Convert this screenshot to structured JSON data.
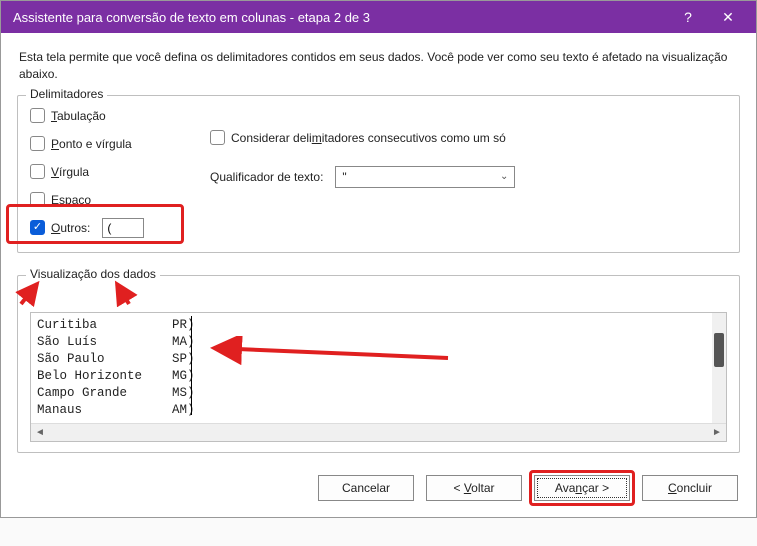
{
  "title": "Assistente para conversão de texto em colunas - etapa 2 de 3",
  "intro": "Esta tela permite que você defina os delimitadores contidos em seus dados. Você pode ver como seu texto é afetado na visualização abaixo.",
  "delimiters": {
    "legend": "Delimitadores",
    "tab": "Tabulação",
    "semicolon": "Ponto e vírgula",
    "comma": "Vírgula",
    "space": "Espaço",
    "other_label": "Outros:",
    "other_value": "(",
    "consecutive": "Considerar delimitadores consecutivos como um só",
    "qualifier_label": "Qualificador de texto:",
    "qualifier_value": "\""
  },
  "preview": {
    "legend": "Visualização dos dados",
    "rows": [
      {
        "c1": "Curitiba",
        "c2": "PR)"
      },
      {
        "c1": "São Luís",
        "c2": "MA)"
      },
      {
        "c1": "São Paulo",
        "c2": "SP)"
      },
      {
        "c1": "Belo Horizonte",
        "c2": "MG)"
      },
      {
        "c1": "Campo Grande",
        "c2": "MS)"
      },
      {
        "c1": "Manaus",
        "c2": "AM)"
      }
    ]
  },
  "buttons": {
    "cancel": "Cancelar",
    "back": "< Voltar",
    "next": "Avançar >",
    "finish": "Concluir"
  }
}
